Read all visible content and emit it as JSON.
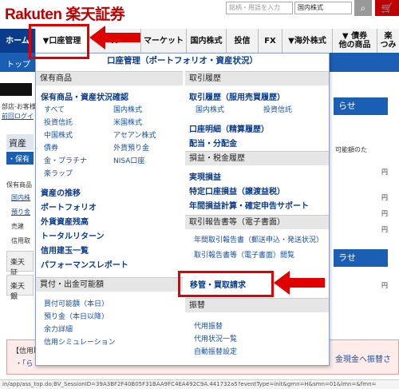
{
  "header": {
    "logo": "Rakuten 楽天証券",
    "search_placeholder": "銘柄・用語を入力",
    "search_scope": "国内株式",
    "search_icon": "search-icon",
    "cart_icon": "cart-icon"
  },
  "nav": {
    "home": "ホーム",
    "account": "▼口座管理",
    "ai": "A",
    "market": "マーケット",
    "domestic": "国内株式",
    "trust": "投信",
    "fx": "FX",
    "foreign": "▼海外株式",
    "bonds": "▼ 債券\n他の商品",
    "tsumitate": "楽\nつみ"
  },
  "subnav": {
    "top": "トップ"
  },
  "dropdown": {
    "title": "口座管理（ポートフォリオ・資産状況）",
    "left": {
      "holdings_header": "保有商品",
      "holdings_main": "保有商品・資産状況確認",
      "items_col1": [
        "すべて",
        "投資信託",
        "中国株式",
        "債券",
        "金・プラチナ",
        "楽ラップ"
      ],
      "items_col2": [
        "国内株式",
        "米国株式",
        "アセアン株式",
        "外貨預り金",
        "NISA口座"
      ],
      "links": [
        "資産の推移",
        "ポートフォリオ",
        "外貨資産残高",
        "トータルリターン",
        "信用建玉一覧",
        "パフォーマンスレポート"
      ],
      "buying_header": "買付・出金可能額",
      "buying_items": [
        "買付可能額（本日）",
        "預り金（本日以降）",
        "余力詳細",
        "信用シミュレーション"
      ]
    },
    "right": {
      "history_header": "取引履歴",
      "history_main": "取引履歴（服用売買履歴）",
      "history_sub": [
        "国内株式",
        "投資信託"
      ],
      "statement": "口座明細（精算履歴）",
      "dividend": "配当・分配金",
      "tax_header": "損益・税金履歴",
      "tax_items": [
        "実現損益",
        "特定口座損益（譲渡益税）",
        "年間損益計算・確定申告サポート"
      ],
      "report_header": "取引報告書等（電子書面）",
      "report_items": [
        "年間取引報告書（郵送申込・発送状況）",
        "取引報告書等（電子書面）閲覧"
      ],
      "transfer_item": "移管・買取請求",
      "furikae_header": "振替",
      "furikae_items": [
        "代用振替",
        "代用状況一覧",
        "自動振替設定"
      ]
    }
  },
  "background": {
    "notice_left": "部店-お客様",
    "login_link": "前回ログイ",
    "section_label": "資産合",
    "tab_label": "・保有",
    "holdings_label": "保有商品",
    "row_labels": [
      "国内株",
      "預り金",
      "売建",
      "信用取"
    ],
    "rakuten_rows": [
      "楽天証",
      "楽天銀"
    ],
    "right_btn": "らせ",
    "right_btn2": "ラせ",
    "right_texts": [
      "可能額のた",
      "円",
      "円",
      "円",
      "円",
      "円"
    ],
    "notice_title": "【信用取",
    "notice_link": "・「ら",
    "notice_right": "金現金へ振替さ",
    "status_url": "in/app/ass_top.do;BV_SessionID=39A3BF2F40B05F31BAA9FC4EA492C9A.441732a5?eventType=init&gmn=H&smn=01&lmn=&fmn="
  },
  "colors": {
    "nav_blue": "#0a3c8c",
    "brand_red": "#bf0000",
    "annotation_red": "#e00000"
  }
}
